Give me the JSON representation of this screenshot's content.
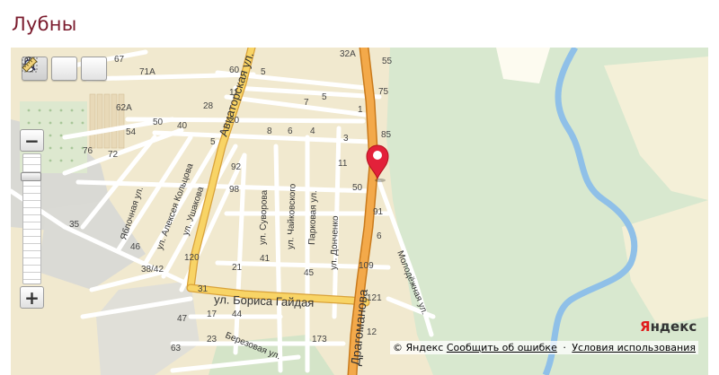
{
  "page": {
    "title": "Лубны"
  },
  "map": {
    "tools": [
      {
        "name": "hand-tool",
        "icon": "hand-icon",
        "active": true
      },
      {
        "name": "magnifier-tool",
        "icon": "magnifier-icon",
        "active": false
      },
      {
        "name": "ruler-tool",
        "icon": "ruler-icon",
        "active": false
      }
    ],
    "zoom": {
      "minus": "−",
      "plus": "+",
      "level_fraction": 0.85
    },
    "streets": {
      "aviatorskaya": "Авиаторская ул.",
      "dragomanova": "Драгоманова",
      "borisa_gaidaya": "ул. Бориса Гайдая",
      "molodezhnaya": "Молодёжная ул.",
      "yablochnaya": "Яблочная ул.",
      "koltsova": "ул. Алексея Кольцова",
      "ushakova": "ул. Ушакова",
      "suvorova": "ул. Суворова",
      "chaikovskogo": "ул. Чайковского",
      "parkovaya": "Парковая ул.",
      "donchenko": "ул. Донченко",
      "berezovaya": "Березовая ул."
    },
    "house_numbers": {
      "n67": "67",
      "n71a": "71А",
      "n60": "60",
      "n5a": "5",
      "n32a": "32А",
      "n55": "55",
      "n11a": "11",
      "n7": "7",
      "n5b": "5",
      "n75": "75",
      "n62a": "62А",
      "n50a": "50",
      "n40": "40",
      "n28": "28",
      "n20": "20",
      "n1": "1",
      "n54": "54",
      "n8": "8",
      "n6": "6",
      "n4": "4",
      "n3": "3",
      "n85": "85",
      "n76": "76",
      "n72": "72",
      "n5c": "5",
      "n92": "92",
      "n98": "98",
      "n11b": "11",
      "n50b": "50",
      "n91": "91",
      "n35": "35",
      "n46": "46",
      "n38_42": "38/42",
      "n120": "120",
      "n21": "21",
      "n41": "41",
      "n45": "45",
      "n109": "109",
      "n6b": "6",
      "n31": "31",
      "n121": "121",
      "n47": "47",
      "n17": "17",
      "n44": "44",
      "n63": "63",
      "n23": "23",
      "n173": "173",
      "n12": "12"
    },
    "logo": {
      "first": "Я",
      "rest": "ндекс"
    },
    "copyright": {
      "symbol": "© Яндекс",
      "report_link": "Сообщить об ошибке",
      "separator": "·",
      "terms_link": "Условия использования"
    }
  }
}
